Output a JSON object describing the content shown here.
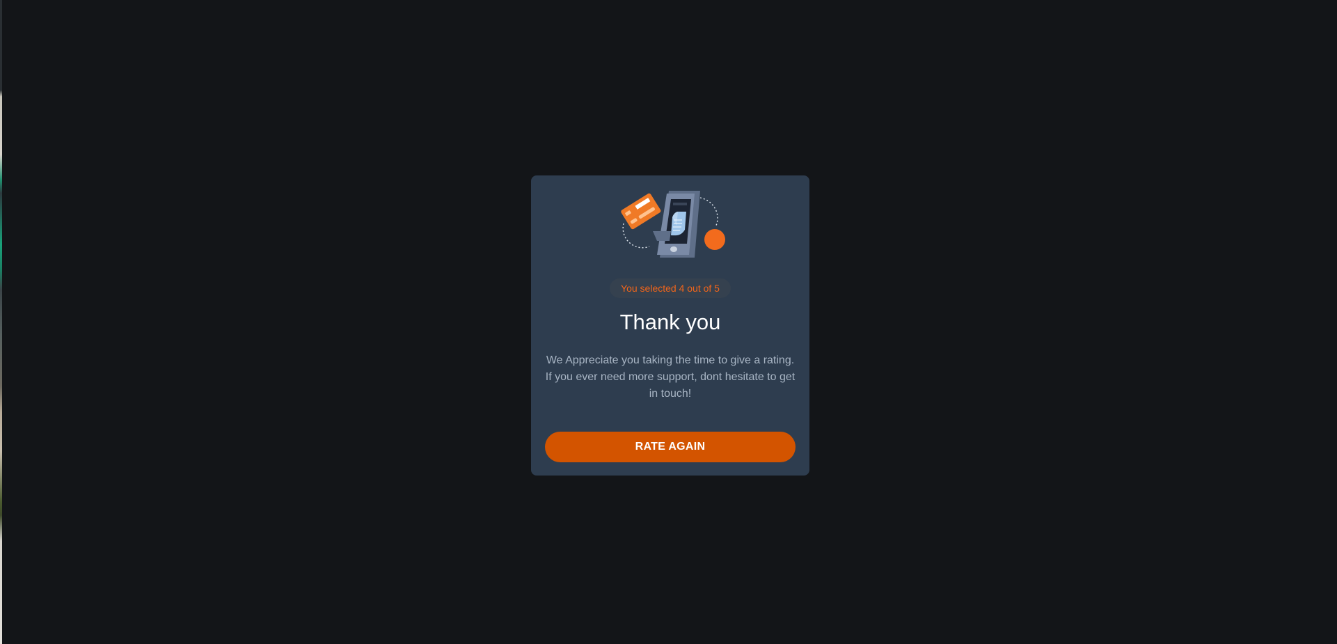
{
  "rating_dialog": {
    "badge_text": "You selected 4 out of 5",
    "title": "Thank you",
    "message": "We Appreciate you taking the time to give a rating. If you ever need more support, dont hesitate to get in touch!",
    "button_label": "RATE AGAIN",
    "illustration": "phone-receipt-card-illustration",
    "colors": {
      "page_background": "#131518",
      "card_background": "#2e3d4f",
      "accent": "#f2651a",
      "button": "#d35400",
      "text_muted": "#a8b5c4"
    }
  }
}
